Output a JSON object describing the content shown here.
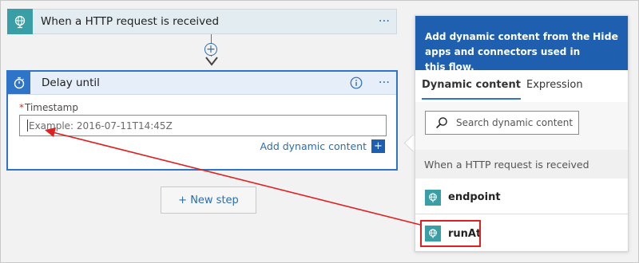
{
  "trigger": {
    "title": "When a HTTP request is received",
    "more": "···"
  },
  "delay": {
    "title": "Delay until",
    "more": "···",
    "field_required_mark": "*",
    "field_label": "Timestamp",
    "field_placeholder": "Example: 2016-07-11T14:45Z",
    "add_dynamic_label": "Add dynamic content",
    "add_dynamic_plus": "+"
  },
  "connector": {
    "plus": "+"
  },
  "new_step": {
    "label": "+ New step"
  },
  "panel": {
    "header_text": "Add dynamic content from the apps and connectors used in this flow.",
    "hide_label": "Hide",
    "tabs": [
      {
        "label": "Dynamic content",
        "active": true
      },
      {
        "label": "Expression",
        "active": false
      }
    ],
    "search_placeholder": "Search dynamic content",
    "section_title": "When a HTTP request is received",
    "tokens": [
      {
        "label": "endpoint"
      },
      {
        "label": "runAt"
      }
    ]
  },
  "colors": {
    "trigger_tile": "#3a9ea7",
    "delay_accent": "#2e74c8",
    "panel_header": "#1f5fb0",
    "annotation": "#e02020"
  },
  "icons": {
    "trigger": "globe-request-icon",
    "delay": "stopwatch-icon",
    "info": "info-icon",
    "search": "search-icon",
    "token": "globe-request-icon"
  }
}
